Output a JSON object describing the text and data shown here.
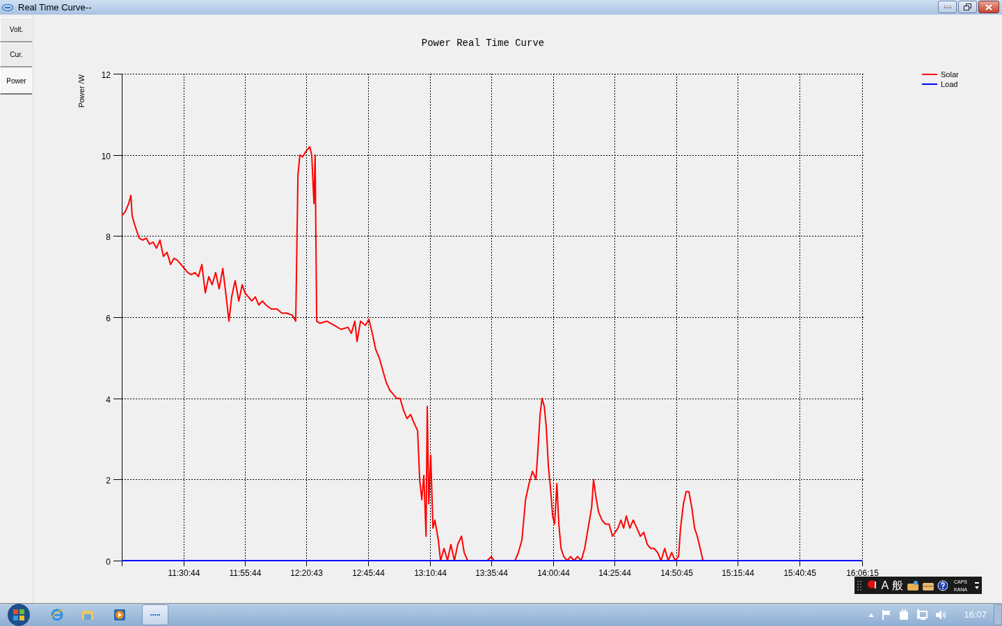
{
  "window": {
    "title": "Real Time Curve--"
  },
  "tabs": [
    {
      "label": "Volt.",
      "selected": false
    },
    {
      "label": "Cur.",
      "selected": false
    },
    {
      "label": "Power",
      "selected": true
    }
  ],
  "chart": {
    "chart_data": {
      "type": "line",
      "grid": true,
      "legend": "right",
      "title": "Power Real Time Curve",
      "ylabel": "Power /W",
      "xlim": [
        39944,
        57975
      ],
      "ylim": [
        0,
        12
      ],
      "yticks": [
        0,
        2,
        4,
        6,
        8,
        10,
        12
      ],
      "xticks": [
        {
          "value": 41444,
          "label": "11:30:44"
        },
        {
          "value": 42944,
          "label": "11:55:44"
        },
        {
          "value": 44443,
          "label": "12:20:43"
        },
        {
          "value": 45944,
          "label": "12:45:44"
        },
        {
          "value": 47444,
          "label": "13:10:44"
        },
        {
          "value": 48944,
          "label": "13:35:44"
        },
        {
          "value": 50444,
          "label": "14:00:44"
        },
        {
          "value": 51944,
          "label": "14:25:44"
        },
        {
          "value": 53445,
          "label": "14:50:45"
        },
        {
          "value": 54944,
          "label": "15:15:44"
        },
        {
          "value": 56445,
          "label": "15:40:45"
        },
        {
          "value": 57975,
          "label": "16:06:15"
        }
      ],
      "series": [
        {
          "name": "Solar",
          "color": "#ff0000",
          "x": [
            39944,
            40028,
            40112,
            40166,
            40196,
            40250,
            40316,
            40370,
            40454,
            40538,
            40622,
            40706,
            40790,
            40874,
            40958,
            41048,
            41132,
            41216,
            41300,
            41384,
            41468,
            41552,
            41636,
            41726,
            41810,
            41894,
            41978,
            42062,
            42146,
            42230,
            42314,
            42404,
            42488,
            42554,
            42620,
            42704,
            42794,
            42878,
            42944,
            43028,
            43112,
            43196,
            43280,
            43370,
            43454,
            43586,
            43724,
            43844,
            43964,
            44096,
            44180,
            44234,
            44282,
            44348,
            44438,
            44522,
            44570,
            44624,
            44654,
            44690,
            44774,
            44942,
            45116,
            45284,
            45452,
            45536,
            45620,
            45674,
            45758,
            45878,
            45962,
            46046,
            46130,
            46214,
            46298,
            46382,
            46472,
            46556,
            46640,
            46724,
            46808,
            46892,
            46976,
            47060,
            47150,
            47198,
            47252,
            47300,
            47354,
            47384,
            47420,
            47468,
            47522,
            47570,
            47654,
            47708,
            47792,
            47876,
            47960,
            48044,
            48128,
            48218,
            48284,
            48368,
            48842,
            48944,
            49010,
            49520,
            49604,
            49688,
            49778,
            49862,
            49946,
            50030,
            50078,
            50132,
            50180,
            50234,
            50282,
            50336,
            50384,
            50438,
            50486,
            50540,
            50588,
            50642,
            50708,
            50792,
            50876,
            50960,
            51044,
            51134,
            51218,
            51302,
            51386,
            51434,
            51488,
            51554,
            51638,
            51722,
            51812,
            51896,
            51962,
            52028,
            52100,
            52166,
            52232,
            52316,
            52400,
            52490,
            52574,
            52658,
            52742,
            52826,
            52910,
            52994,
            53078,
            53168,
            53252,
            53336,
            53420,
            53504,
            53552,
            53624,
            53690,
            53756,
            53828,
            53894,
            53960,
            54032,
            54098,
            57975
          ],
          "values": [
            8.5,
            8.6,
            8.8,
            9.0,
            8.5,
            8.3,
            8.1,
            7.95,
            7.9,
            7.95,
            7.8,
            7.85,
            7.7,
            7.9,
            7.5,
            7.6,
            7.3,
            7.45,
            7.4,
            7.3,
            7.2,
            7.1,
            7.05,
            7.1,
            7.0,
            7.3,
            6.6,
            7.0,
            6.8,
            7.1,
            6.7,
            7.2,
            6.5,
            5.9,
            6.5,
            6.9,
            6.4,
            6.8,
            6.6,
            6.5,
            6.4,
            6.5,
            6.3,
            6.4,
            6.3,
            6.2,
            6.2,
            6.1,
            6.1,
            6.05,
            5.9,
            9.5,
            10.0,
            9.95,
            10.1,
            10.2,
            10.0,
            8.8,
            10.0,
            5.9,
            5.85,
            5.9,
            5.8,
            5.7,
            5.75,
            5.6,
            5.9,
            5.4,
            5.9,
            5.8,
            5.95,
            5.6,
            5.2,
            5.0,
            4.7,
            4.4,
            4.2,
            4.1,
            4.0,
            4.0,
            3.7,
            3.5,
            3.6,
            3.4,
            3.2,
            2.0,
            1.5,
            2.1,
            0.6,
            3.8,
            1.4,
            2.6,
            0.8,
            1.0,
            0.5,
            0.0,
            0.3,
            0.0,
            0.4,
            0.0,
            0.4,
            0.6,
            0.2,
            0.0,
            0.0,
            0.1,
            0.0,
            0.0,
            0.2,
            0.5,
            1.5,
            1.9,
            2.2,
            2.0,
            2.7,
            3.6,
            4.0,
            3.8,
            3.3,
            2.3,
            1.8,
            1.1,
            0.9,
            1.9,
            0.9,
            0.3,
            0.1,
            0.0,
            0.1,
            0.0,
            0.1,
            0.0,
            0.3,
            0.8,
            1.3,
            2.0,
            1.6,
            1.2,
            1.0,
            0.9,
            0.9,
            0.6,
            0.7,
            0.8,
            1.0,
            0.8,
            1.1,
            0.8,
            1.0,
            0.8,
            0.6,
            0.7,
            0.4,
            0.3,
            0.3,
            0.2,
            0.0,
            0.3,
            0.0,
            0.2,
            0.0,
            0.1,
            0.8,
            1.4,
            1.7,
            1.7,
            1.3,
            0.8,
            0.6,
            0.3,
            0.0,
            0.0
          ]
        },
        {
          "name": "Load",
          "color": "#0000ff",
          "x": [
            39944,
            57975
          ],
          "values": [
            0,
            0
          ]
        }
      ]
    }
  },
  "ime_bar": {
    "mode": "A",
    "input": "般",
    "caps": "CAPS",
    "kana": "KANA"
  },
  "taskbar": {
    "clock": "16:07"
  }
}
